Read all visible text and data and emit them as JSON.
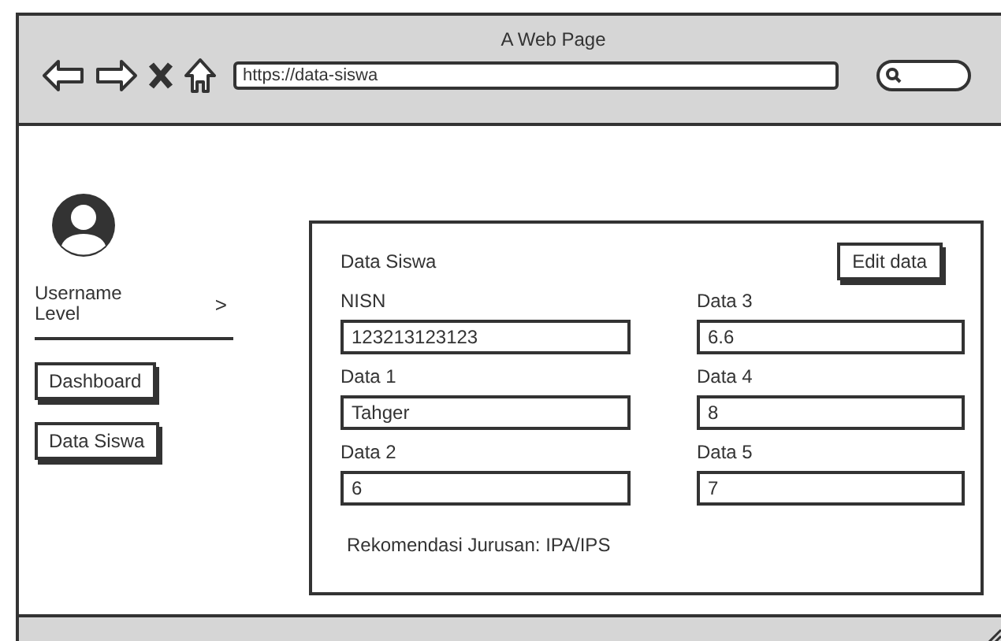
{
  "window": {
    "title": "A Web Page"
  },
  "browser": {
    "url": "https://data-siswa"
  },
  "sidebar": {
    "user": {
      "name": "Username",
      "level": "Level",
      "chevron": ">"
    },
    "items": [
      {
        "label": "Dashboard"
      },
      {
        "label": "Data Siswa"
      }
    ]
  },
  "card": {
    "title": "Data Siswa",
    "edit_button": "Edit data",
    "fields": [
      {
        "label": "NISN",
        "value": "123213123123"
      },
      {
        "label": "Data 3",
        "value": "6.6"
      },
      {
        "label": "Data 1",
        "value": "Tahger"
      },
      {
        "label": "Data 4",
        "value": "8"
      },
      {
        "label": "Data 2",
        "value": "6"
      },
      {
        "label": "Data 5",
        "value": "7"
      }
    ],
    "recommendation": "Rekomendasi Jurusan: IPA/IPS"
  }
}
